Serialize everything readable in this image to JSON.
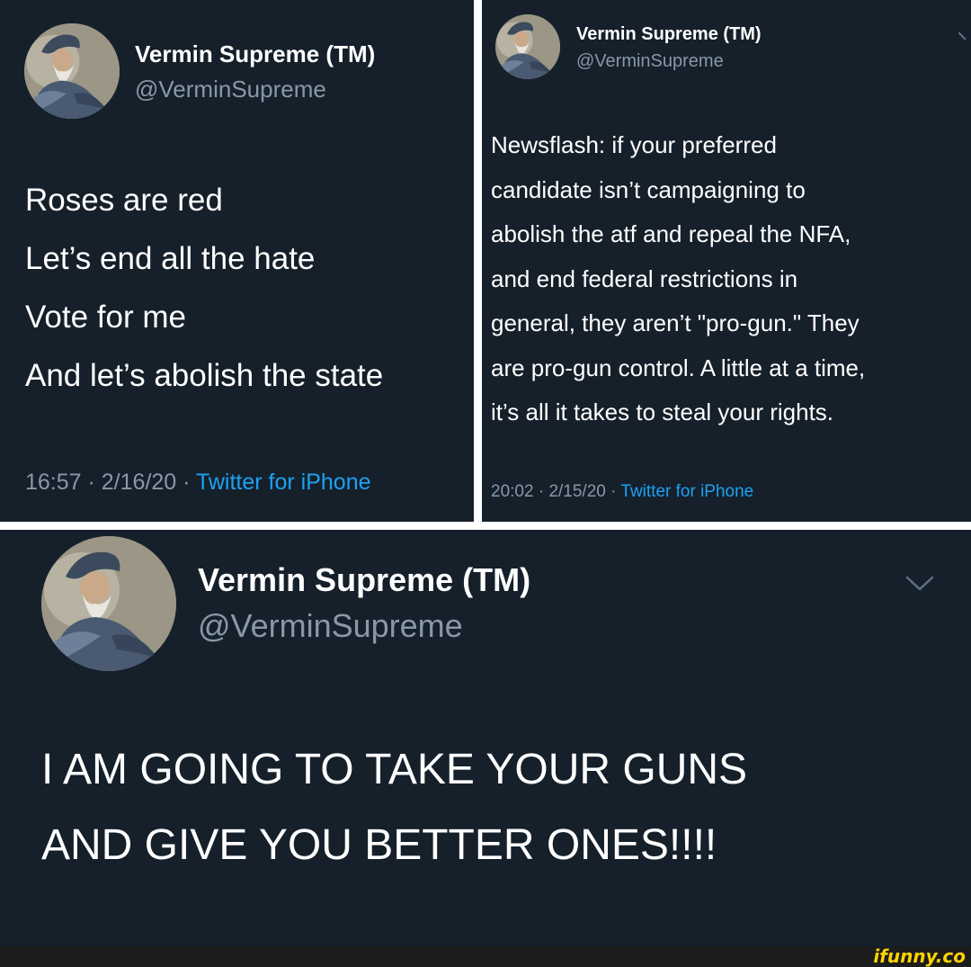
{
  "colors": {
    "background": "#15202b",
    "name_text": "#ffffff",
    "handle_text": "#8899a6",
    "link_blue": "#1da1f2",
    "divider": "#ffffff",
    "watermark": "#ffd400"
  },
  "tweets": [
    {
      "author": {
        "name": "Vermin Supreme (TM)",
        "handle": "@VerminSupreme",
        "avatar_icon": "bearded-man-avatar"
      },
      "body_lines": [
        "Roses are red",
        "Let’s end all the hate",
        "Vote for me",
        "And let’s abolish the state"
      ],
      "meta": {
        "time": "16:57",
        "date": "2/16/20",
        "client": "Twitter for iPhone"
      }
    },
    {
      "author": {
        "name": "Vermin Supreme (TM)",
        "handle": "@VerminSupreme",
        "avatar_icon": "bearded-man-avatar"
      },
      "body_lines": [
        "Newsflash: if your preferred",
        "candidate isn’t campaigning to",
        "abolish the atf and repeal the NFA,",
        "and end federal restrictions in",
        "general, they aren’t \"pro-gun.\" They",
        "are pro-gun control. A little at a time,",
        "it’s all it takes to steal your rights."
      ],
      "meta": {
        "time": "20:02",
        "date": "2/15/20",
        "client": "Twitter for iPhone"
      }
    },
    {
      "author": {
        "name": "Vermin Supreme (TM)",
        "handle": "@VerminSupreme",
        "avatar_icon": "bearded-man-avatar"
      },
      "body_lines": [
        "I AM GOING TO TAKE YOUR GUNS",
        "AND GIVE YOU BETTER ONES!!!!"
      ],
      "menu_icon": "chevron-down-icon"
    }
  ],
  "watermark": "ifunny.co"
}
